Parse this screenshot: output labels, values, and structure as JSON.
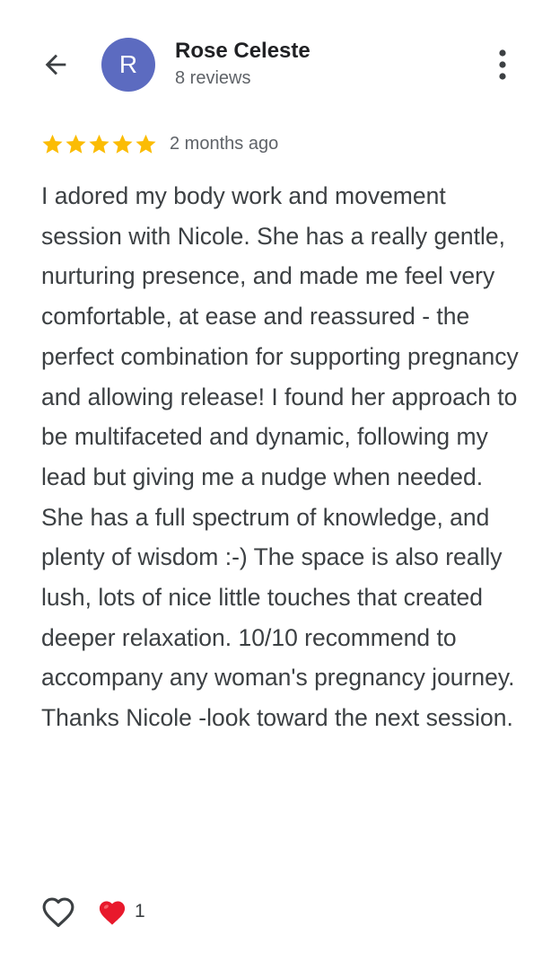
{
  "header": {
    "back_icon": "arrow-left-icon",
    "avatar_initial": "R",
    "avatar_color": "#5c6bc0",
    "reviewer_name": "Rose Celeste",
    "reviewer_meta": "8 reviews",
    "more_icon": "more-vertical-icon"
  },
  "review": {
    "rating": 5,
    "rating_max": 5,
    "star_color": "#fbbc04",
    "time": "2 months ago",
    "text": "I adored my body work and movement session with Nicole. She has a really gentle, nurturing presence, and made me feel very comfortable, at ease and reassured - the perfect combination for supporting pregnancy and allowing release! I found her approach to be multifaceted and dynamic, following my lead but giving me a nudge when needed. She has a full spectrum of knowledge, and plenty of wisdom :-) The space is also really lush, lots of nice little touches that created deeper relaxation. 10/10 recommend to accompany any woman's pregnancy journey. Thanks Nicole -look toward the next session."
  },
  "reactions": {
    "like_icon": "heart-outline-icon",
    "reaction_icon": "red-heart-icon",
    "reaction_color": "#e8192c",
    "count": "1"
  }
}
